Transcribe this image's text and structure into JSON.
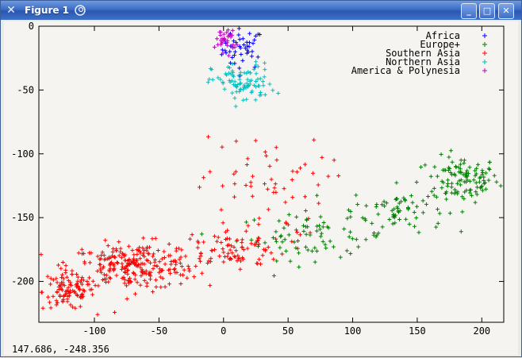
{
  "window": {
    "title": "Figure 1",
    "icons": {
      "menu": "x-logo-icon",
      "app": "swirl-icon"
    },
    "buttons": {
      "minimize": "minimize-icon",
      "maximize": "maximize-icon",
      "close": "close-icon"
    }
  },
  "status": {
    "coordinates": "147.686, -248.356"
  },
  "chart_data": {
    "type": "scatter",
    "title": "",
    "xlabel": "",
    "ylabel": "",
    "xlim": [
      -143,
      217
    ],
    "ylim": [
      -232,
      0
    ],
    "xticks": [
      -100,
      -50,
      0,
      50,
      100,
      150,
      200
    ],
    "yticks": [
      0,
      -50,
      -100,
      -150,
      -200
    ],
    "grid": false,
    "legend": "top-right",
    "series": [
      {
        "name": "Africa",
        "color": "#0000ff",
        "clusters": [
          {
            "cx": 15,
            "cy": -18,
            "sx": 8,
            "sy": 8,
            "n": 45
          }
        ]
      },
      {
        "name": "Europe+",
        "color": "#008000",
        "clusters": [
          {
            "cx": 185,
            "cy": -120,
            "sx": 14,
            "sy": 9,
            "n": 110
          },
          {
            "cx": 135,
            "cy": -143,
            "sx": 18,
            "sy": 9,
            "n": 70
          },
          {
            "cx": 70,
            "cy": -165,
            "sx": 30,
            "sy": 9,
            "n": 80
          }
        ]
      },
      {
        "name": "Southern Asia",
        "color": "#ff0000",
        "clusters": [
          {
            "cx": -120,
            "cy": -208,
            "sx": 10,
            "sy": 7,
            "n": 100
          },
          {
            "cx": -70,
            "cy": -188,
            "sx": 25,
            "sy": 9,
            "n": 260
          },
          {
            "cx": 5,
            "cy": -175,
            "sx": 22,
            "sy": 8,
            "n": 90
          },
          {
            "cx": 30,
            "cy": -125,
            "sx": 25,
            "sy": 20,
            "n": 60
          }
        ]
      },
      {
        "name": "Northern Asia",
        "color": "#00c0c0",
        "clusters": [
          {
            "cx": 15,
            "cy": -45,
            "sx": 12,
            "sy": 8,
            "n": 90
          }
        ]
      },
      {
        "name": "America & Polynesia",
        "color": "#c000c0",
        "clusters": [
          {
            "cx": 2,
            "cy": -10,
            "sx": 4,
            "sy": 5,
            "n": 35
          }
        ]
      }
    ]
  }
}
